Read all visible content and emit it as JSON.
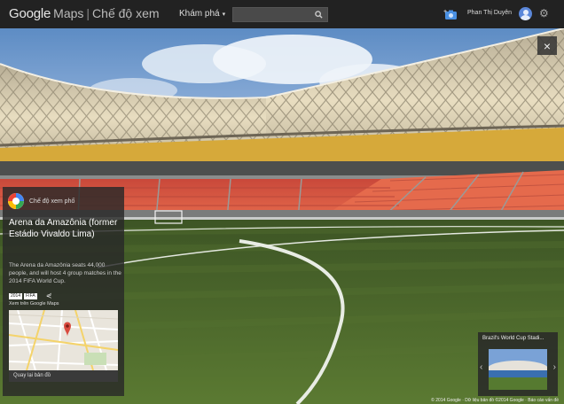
{
  "topbar": {
    "brand_google": "Google",
    "brand_maps": "Maps",
    "brand_separator": "|",
    "brand_mode": "Chế độ xem",
    "explore_label": "Khám phá",
    "search_placeholder": "",
    "user_name": "Phan Thị Duyên",
    "icons": {
      "search": "search-icon",
      "camera": "add-photo-icon",
      "avatar": "avatar",
      "settings": "gear-icon"
    }
  },
  "scene": {
    "close_label": "×"
  },
  "panel": {
    "source_label": "Chế độ xem phố",
    "title": "Arena da Amazônia (former Estádio Vivaldo Lima)",
    "description": "The Arena da Amazônia seats 44,000 people, and will host 4 group matches in the 2014 FIFA World Cup.",
    "badge_1": "2014",
    "badge_2": "FIFA",
    "share_icon": "share-icon",
    "link": "Xem trên Google Maps",
    "map_footer": "Quay lại bản đồ"
  },
  "thumbnail": {
    "title": "Brazil's World Cup Stadi...",
    "prev": "‹",
    "next": "›"
  },
  "footer": {
    "text": "© 2014 Google · Dữ liệu bản đồ ©2014 Google · Báo cáo vấn đề"
  },
  "colors": {
    "topbar": "#222222",
    "panel": "#282828",
    "seats": "#e0563a",
    "roof": "#e6d9b5",
    "pitch": "#4f6a2b",
    "sky": "#6b96c8"
  }
}
